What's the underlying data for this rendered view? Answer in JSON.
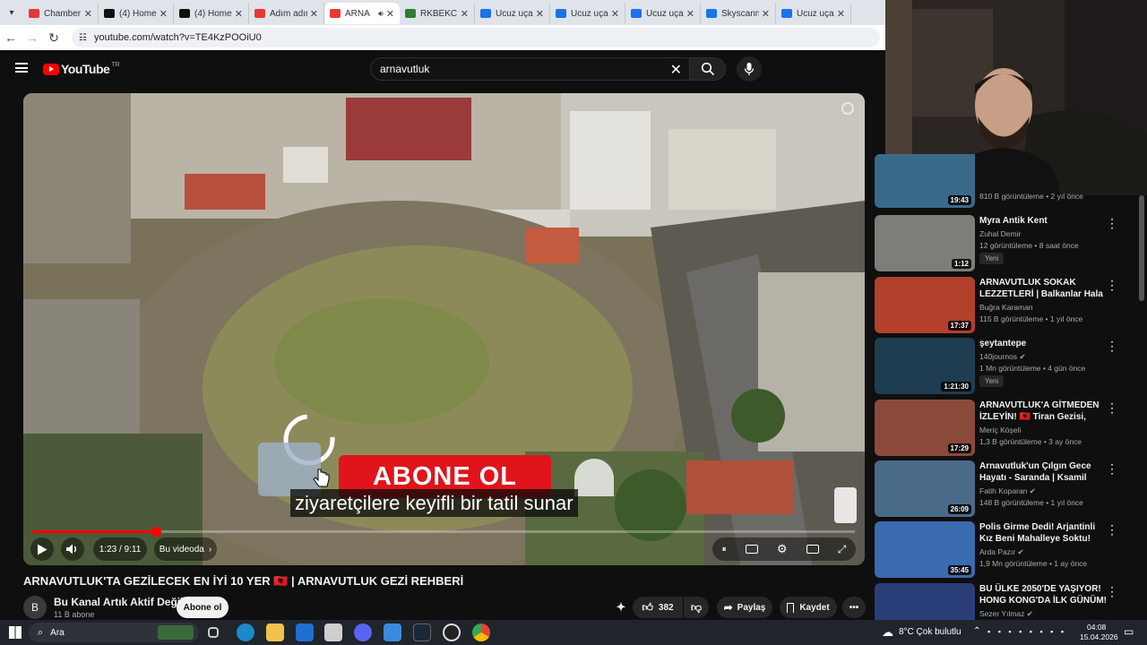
{
  "browser": {
    "tabs": [
      {
        "label": "Chamber ",
        "color": "#e53935"
      },
      {
        "label": "(4) Home",
        "color": "#111111"
      },
      {
        "label": "(4) Home",
        "color": "#111111"
      },
      {
        "label": "Adım adım",
        "color": "#e53935"
      },
      {
        "label": "ARNA",
        "color": "#e53935",
        "active": true
      },
      {
        "label": "RKBEKCI -",
        "color": "#2e7d32"
      },
      {
        "label": "Ucuz uçak",
        "color": "#1a73e8"
      },
      {
        "label": "Ucuz uçak",
        "color": "#1a73e8"
      },
      {
        "label": "Ucuz uçak",
        "color": "#1a73e8"
      },
      {
        "label": "Skyscanne",
        "color": "#1a73e8"
      },
      {
        "label": "Ucuz uçak",
        "color": "#1a73e8"
      }
    ],
    "url": "youtube.com/watch?v=TE4KzPOOiU0"
  },
  "youtube": {
    "logo_text": "YouTube",
    "logo_region": "TR",
    "search_value": "arnavutluk",
    "accent": "#ff0000"
  },
  "player": {
    "caption": "ziyaretçilere keyifli bir tatil sunar",
    "overlay_button": "ABONE OL",
    "time": "1:23 / 9:11",
    "chapter": "Bu videoda",
    "progress": 0.1506
  },
  "video": {
    "title": "ARNAVUTLUK'TA GEZİLECEK EN İYİ 10 YER 🇦🇱 | ARNAVUTLUK GEZİ REHBERİ",
    "channel": "Bu Kanal Artık Aktif Değil",
    "channel_initial": "B",
    "subscribers": "11 B abone",
    "subscribe_label": "Abone ol",
    "likes": "382",
    "share_label": "Paylaş",
    "save_label": "Kaydet"
  },
  "sidebar": {
    "partial_top": {
      "views": "810 B görüntüleme • 2 yıl önce",
      "duration": "19:43"
    },
    "items": [
      {
        "title": "Myra Antik  Kent",
        "channel": "Zuhal Demir",
        "verified": false,
        "views": "12 görüntüleme • 8 saat önce",
        "duration": "1:12",
        "badge": "Yeni",
        "thumb": "#7c7f77"
      },
      {
        "title": "ARNAVUTLUK SOKAK LEZZETLERİ | Balkanlar Hala ...",
        "channel": "Buğra Karaman",
        "verified": false,
        "views": "115 B görüntüleme • 1 yıl önce",
        "duration": "17:37",
        "badge": "",
        "thumb": "#b3402a"
      },
      {
        "title": "şeytantepe",
        "channel": "140journos",
        "verified": true,
        "views": "1 Mn görüntüleme • 4 gün önce",
        "duration": "1:21:30",
        "badge": "Yeni",
        "thumb": "#1f3d50"
      },
      {
        "title": "ARNAVUTLUK'A GİTMEDEN İZLEYİN! 🇦🇱 Tiran Gezisi, Otell...",
        "channel": "Meriç Köşeli",
        "verified": false,
        "views": "1,3 B görüntüleme • 3 ay önce",
        "duration": "17:29",
        "badge": "",
        "thumb": "#8a4a3a"
      },
      {
        "title": "Arnavutluk'un Çılgın Gece Hayatı - Saranda | Ksamil",
        "channel": "Fatih Koparan",
        "verified": true,
        "views": "148 B görüntüleme • 1 yıl önce",
        "duration": "26:09",
        "badge": "",
        "thumb": "#4a6a8a"
      },
      {
        "title": "Polis Girme Dedi! Arjantinli Kız Beni Mahalleye Soktu! Villa 31",
        "channel": "Arda Pazır",
        "verified": true,
        "views": "1,9 Mn görüntüleme • 1 ay önce",
        "duration": "35:45",
        "badge": "",
        "thumb": "#3a6ab0"
      },
      {
        "title": "BU ÜLKE 2050'DE YAŞIYOR! HONG KONG'DA İLK GÜNÜM!",
        "channel": "Sezer Yılmaz",
        "verified": true,
        "views": "",
        "duration": "",
        "badge": "",
        "thumb": "#2a3e7a"
      }
    ]
  },
  "taskbar": {
    "search_label": "Ara",
    "weather": "8°C  Çok bulutlu",
    "time": "04:08",
    "date": "15.04.2026"
  }
}
